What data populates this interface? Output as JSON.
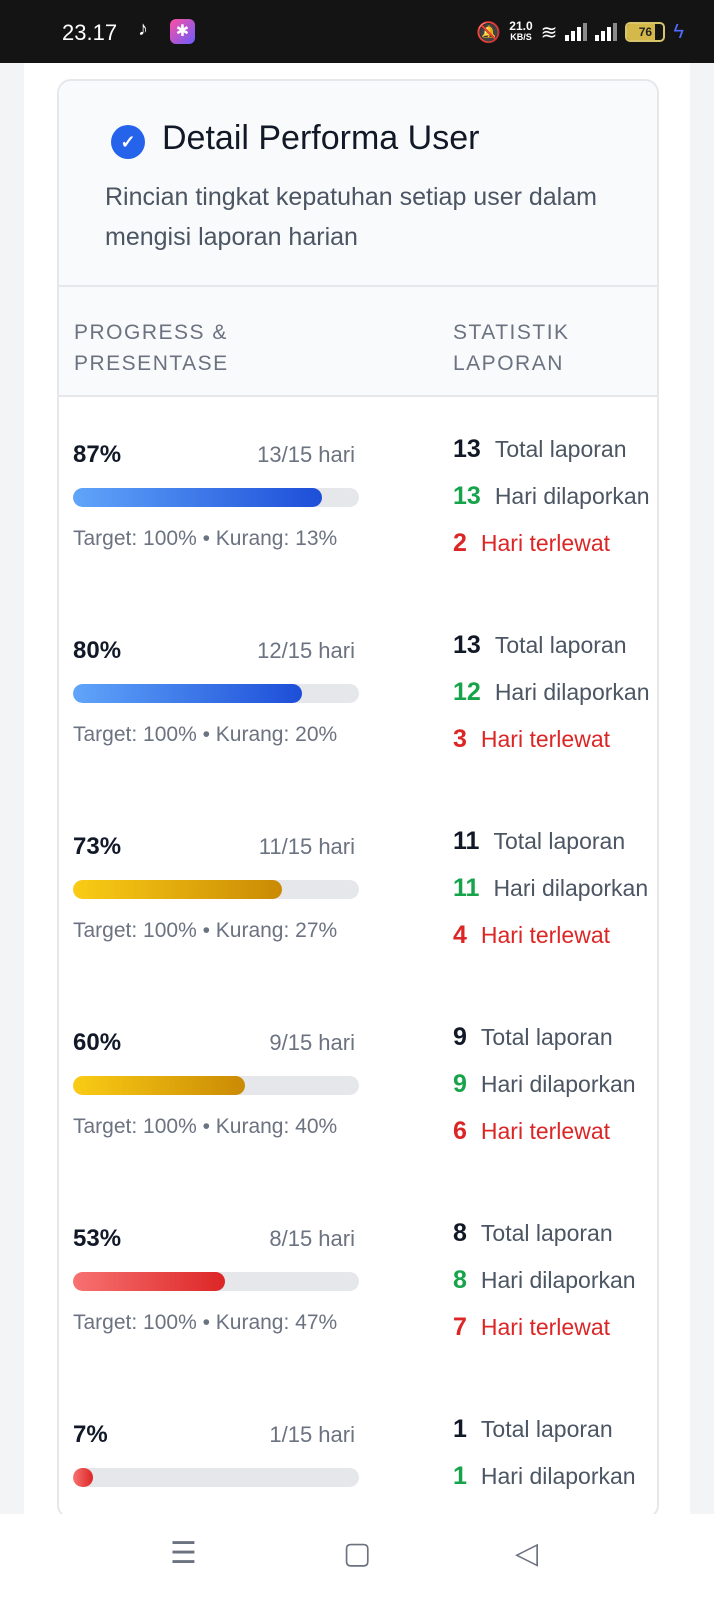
{
  "status_bar": {
    "time": "23.17",
    "net_speed": "21.0",
    "net_unit": "KB/S",
    "battery": "76"
  },
  "card": {
    "title": "Detail Performa User",
    "description": "Rincian tingkat kepatuhan setiap user dalam mengisi laporan harian"
  },
  "table": {
    "col_progress": "PROGRESS & PRESENTASE",
    "col_stats": "STATISTIK LAPORAN",
    "rows": [
      {
        "percent": "87%",
        "progress": 0.87,
        "days": "13/15 hari",
        "target": "Target: 100% • Kurang: 13%",
        "total": "13",
        "total_label": "Total laporan",
        "reported": "13",
        "reported_label": "Hari dilaporkan",
        "missed": "2",
        "missed_label": "Hari terlewat",
        "color": "blue"
      },
      {
        "percent": "80%",
        "progress": 0.8,
        "days": "12/15 hari",
        "target": "Target: 100% • Kurang: 20%",
        "total": "13",
        "total_label": "Total laporan",
        "reported": "12",
        "reported_label": "Hari dilaporkan",
        "missed": "3",
        "missed_label": "Hari terlewat",
        "color": "blue"
      },
      {
        "percent": "73%",
        "progress": 0.73,
        "days": "11/15 hari",
        "target": "Target: 100% • Kurang: 27%",
        "total": "11",
        "total_label": "Total laporan",
        "reported": "11",
        "reported_label": "Hari dilaporkan",
        "missed": "4",
        "missed_label": "Hari terlewat",
        "color": "yellow"
      },
      {
        "percent": "60%",
        "progress": 0.6,
        "days": "9/15 hari",
        "target": "Target: 100% • Kurang: 40%",
        "total": "9",
        "total_label": "Total laporan",
        "reported": "9",
        "reported_label": "Hari dilaporkan",
        "missed": "6",
        "missed_label": "Hari terlewat",
        "color": "yellow"
      },
      {
        "percent": "53%",
        "progress": 0.53,
        "days": "8/15 hari",
        "target": "Target: 100% • Kurang: 47%",
        "total": "8",
        "total_label": "Total laporan",
        "reported": "8",
        "reported_label": "Hari dilaporkan",
        "missed": "7",
        "missed_label": "Hari terlewat",
        "color": "red"
      },
      {
        "percent": "7%",
        "progress": 0.07,
        "days": "1/15 hari",
        "target": "",
        "total": "1",
        "total_label": "Total laporan",
        "reported": "1",
        "reported_label": "Hari dilaporkan",
        "missed": "",
        "missed_label": "",
        "color": "red"
      }
    ]
  },
  "colors": {
    "blue": [
      "#60a5fa",
      "#1d4ed8"
    ],
    "yellow": [
      "#facc15",
      "#ca8a04"
    ],
    "red": [
      "#f87171",
      "#dc2626"
    ]
  }
}
